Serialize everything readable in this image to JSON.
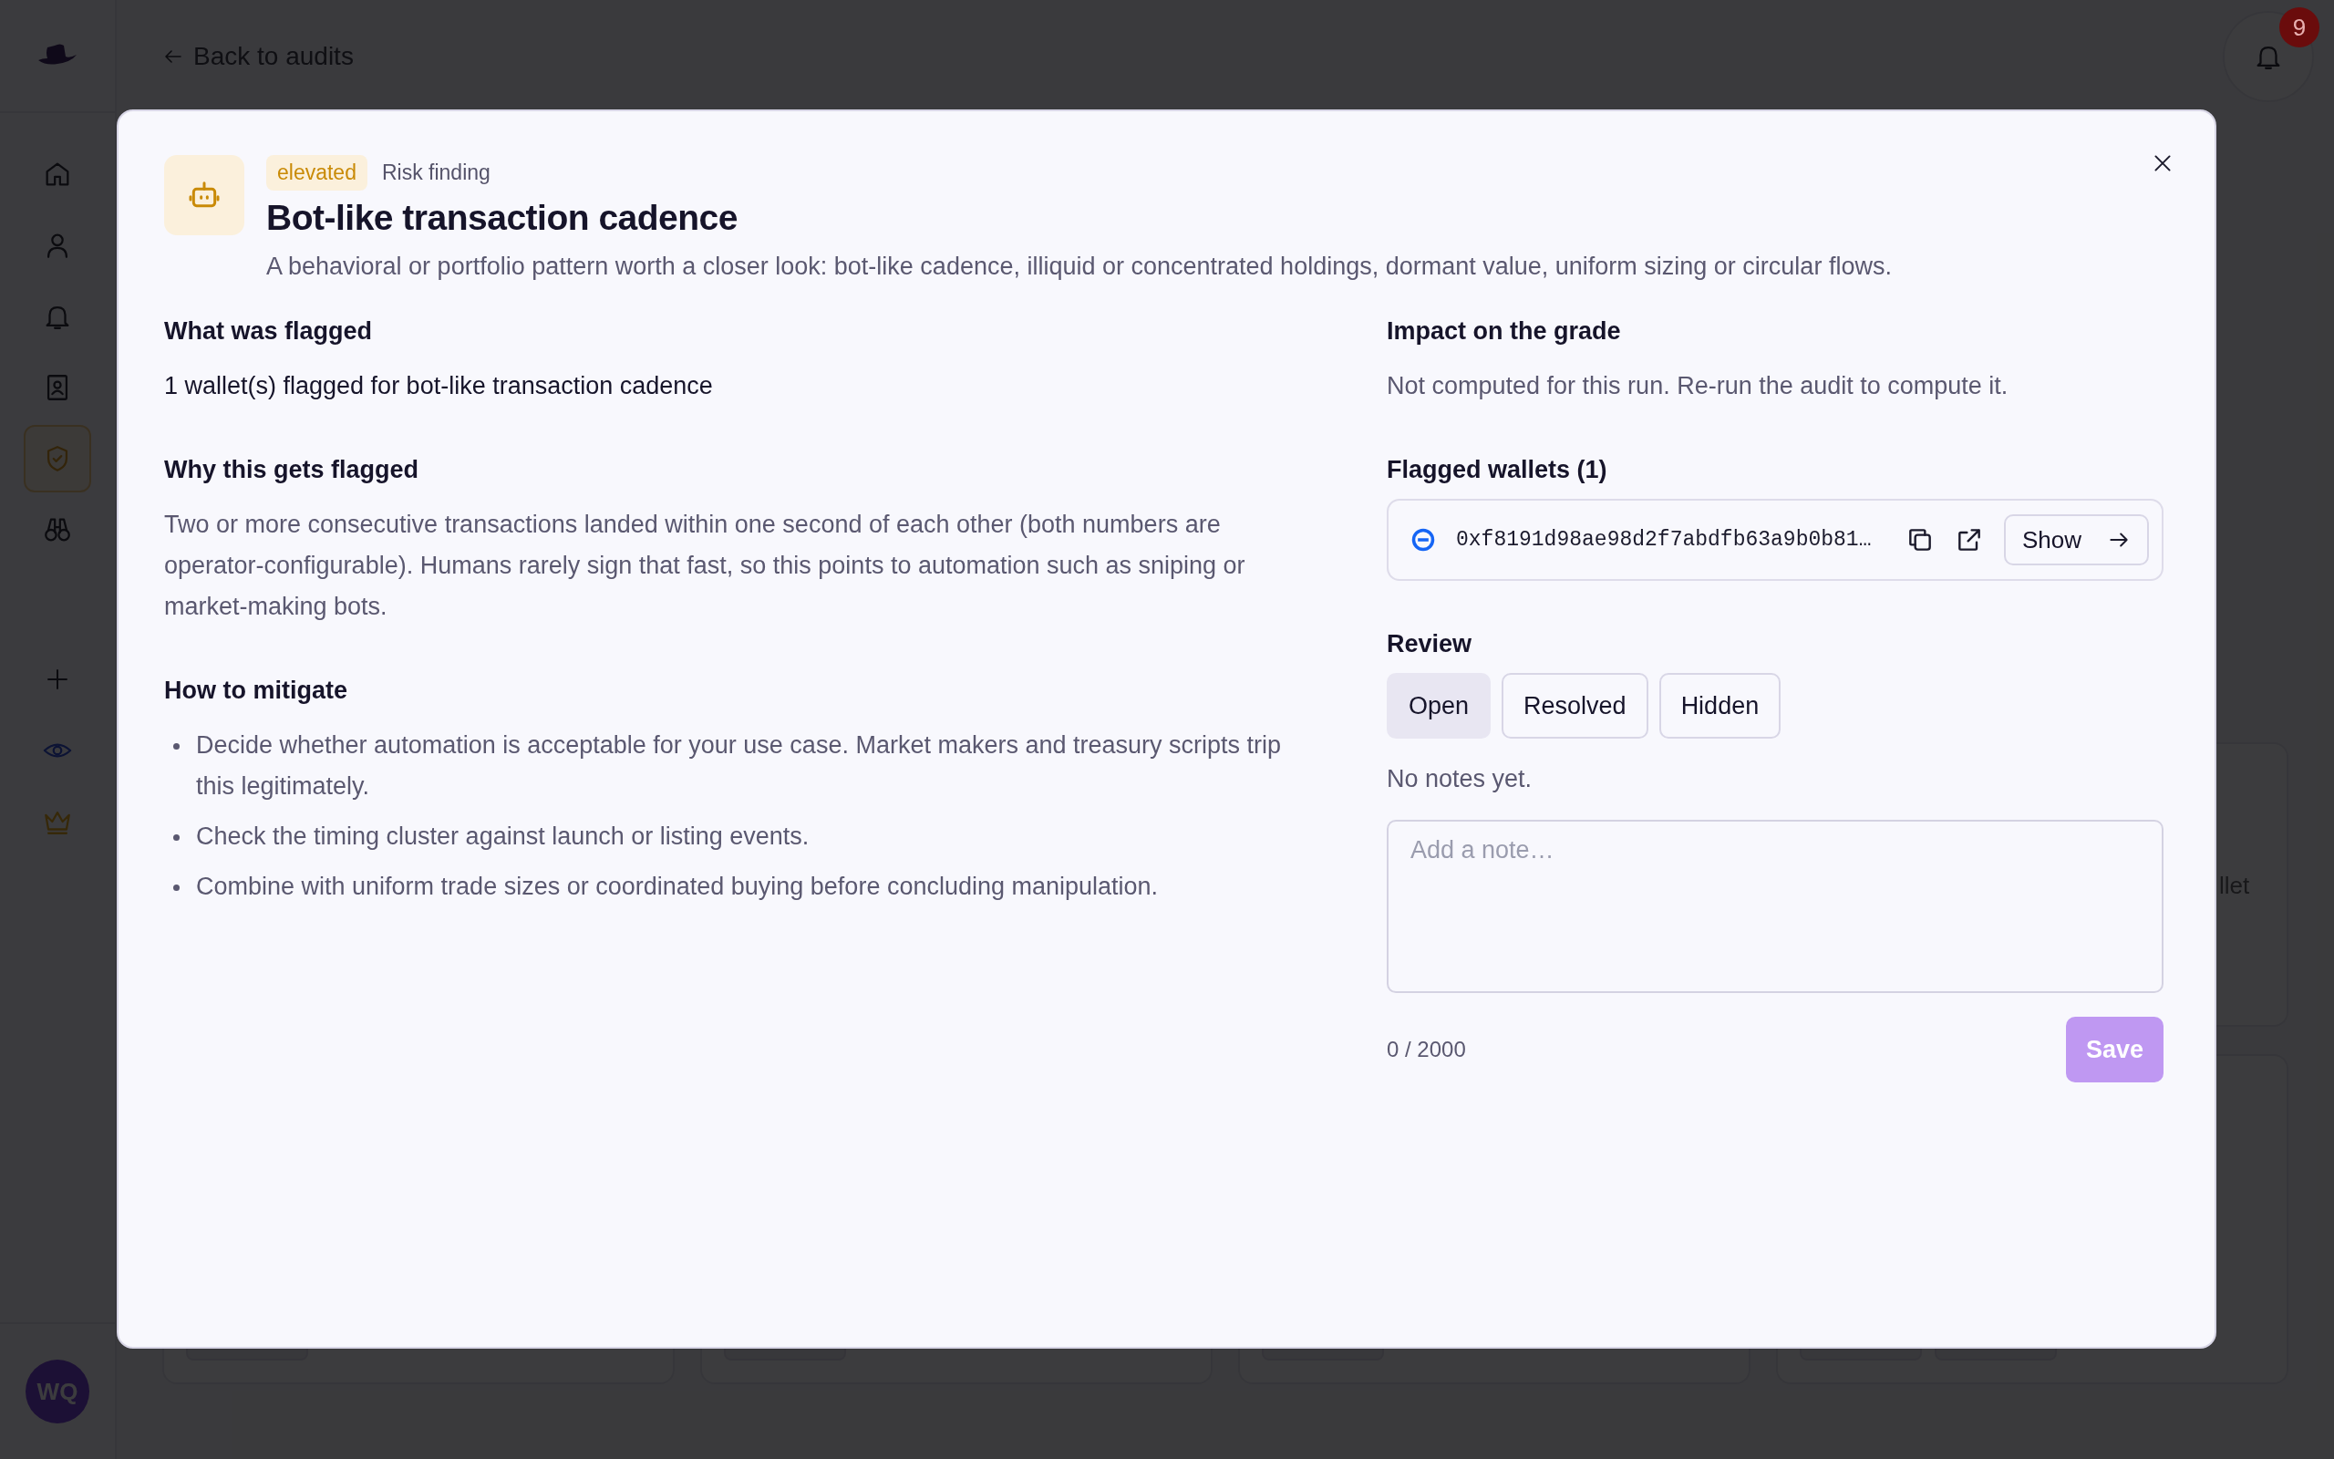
{
  "sidebar": {
    "nav_items": [
      {
        "kind": "home",
        "selected": false
      },
      {
        "kind": "user",
        "selected": false
      },
      {
        "kind": "bell",
        "selected": false
      },
      {
        "kind": "contacts",
        "selected": false
      },
      {
        "kind": "shield",
        "selected": true
      },
      {
        "kind": "binoculars",
        "selected": false
      }
    ],
    "tool_items": [
      {
        "kind": "plus"
      },
      {
        "kind": "eye"
      },
      {
        "kind": "crown"
      }
    ],
    "avatar": {
      "initials": "WQ"
    }
  },
  "topbar": {
    "back_link": "Back to audits",
    "notifications": {
      "badge": "9"
    }
  },
  "background_card_fragment": {
    "text": "llet"
  },
  "modal": {
    "severity": "elevated",
    "category": "Risk finding",
    "title": "Bot-like transaction cadence",
    "description": "A behavioral or portfolio pattern worth a closer look: bot-like cadence, illiquid or concentrated holdings, dormant value, uniform sizing or circular flows.",
    "sections": [
      {
        "kind": "text",
        "heading": "What was flagged",
        "text": "1 wallet(s) flagged for bot-like transaction cadence"
      },
      {
        "kind": "paragraph",
        "heading": "Why this gets flagged",
        "text": "Two or more consecutive transactions landed within one second of each other (both numbers are operator-configurable). Humans rarely sign that fast, so this points to automation such as sniping or market-making bots."
      },
      {
        "kind": "list",
        "heading": "How to mitigate",
        "items": [
          "Decide whether automation is acceptable for your use case. Market makers and treasury scripts trip this legitimately.",
          "Check the timing cluster against launch or listing events.",
          "Combine with uniform trade sizes or coordinated buying before concluding manipulation."
        ]
      }
    ],
    "impact": {
      "heading": "Impact on the grade",
      "text": "Not computed for this run. Re-run the audit to compute it."
    },
    "flagged_wallets": {
      "heading": "Flagged wallets (1)",
      "wallets": [
        {
          "address": "0xf8191d98ae98d2f7abdfb63a9b0b81…",
          "action": "Show"
        }
      ]
    },
    "review": {
      "heading": "Review",
      "statuses": [
        {
          "label": "Open",
          "selected": true
        },
        {
          "label": "Resolved",
          "selected": false
        },
        {
          "label": "Hidden",
          "selected": false
        }
      ],
      "notes_empty": "No notes yet.",
      "note": {
        "placeholder": "Add a note…"
      },
      "counter": "0 / 2000",
      "save": {
        "label": "Save",
        "disabled": true
      }
    }
  }
}
